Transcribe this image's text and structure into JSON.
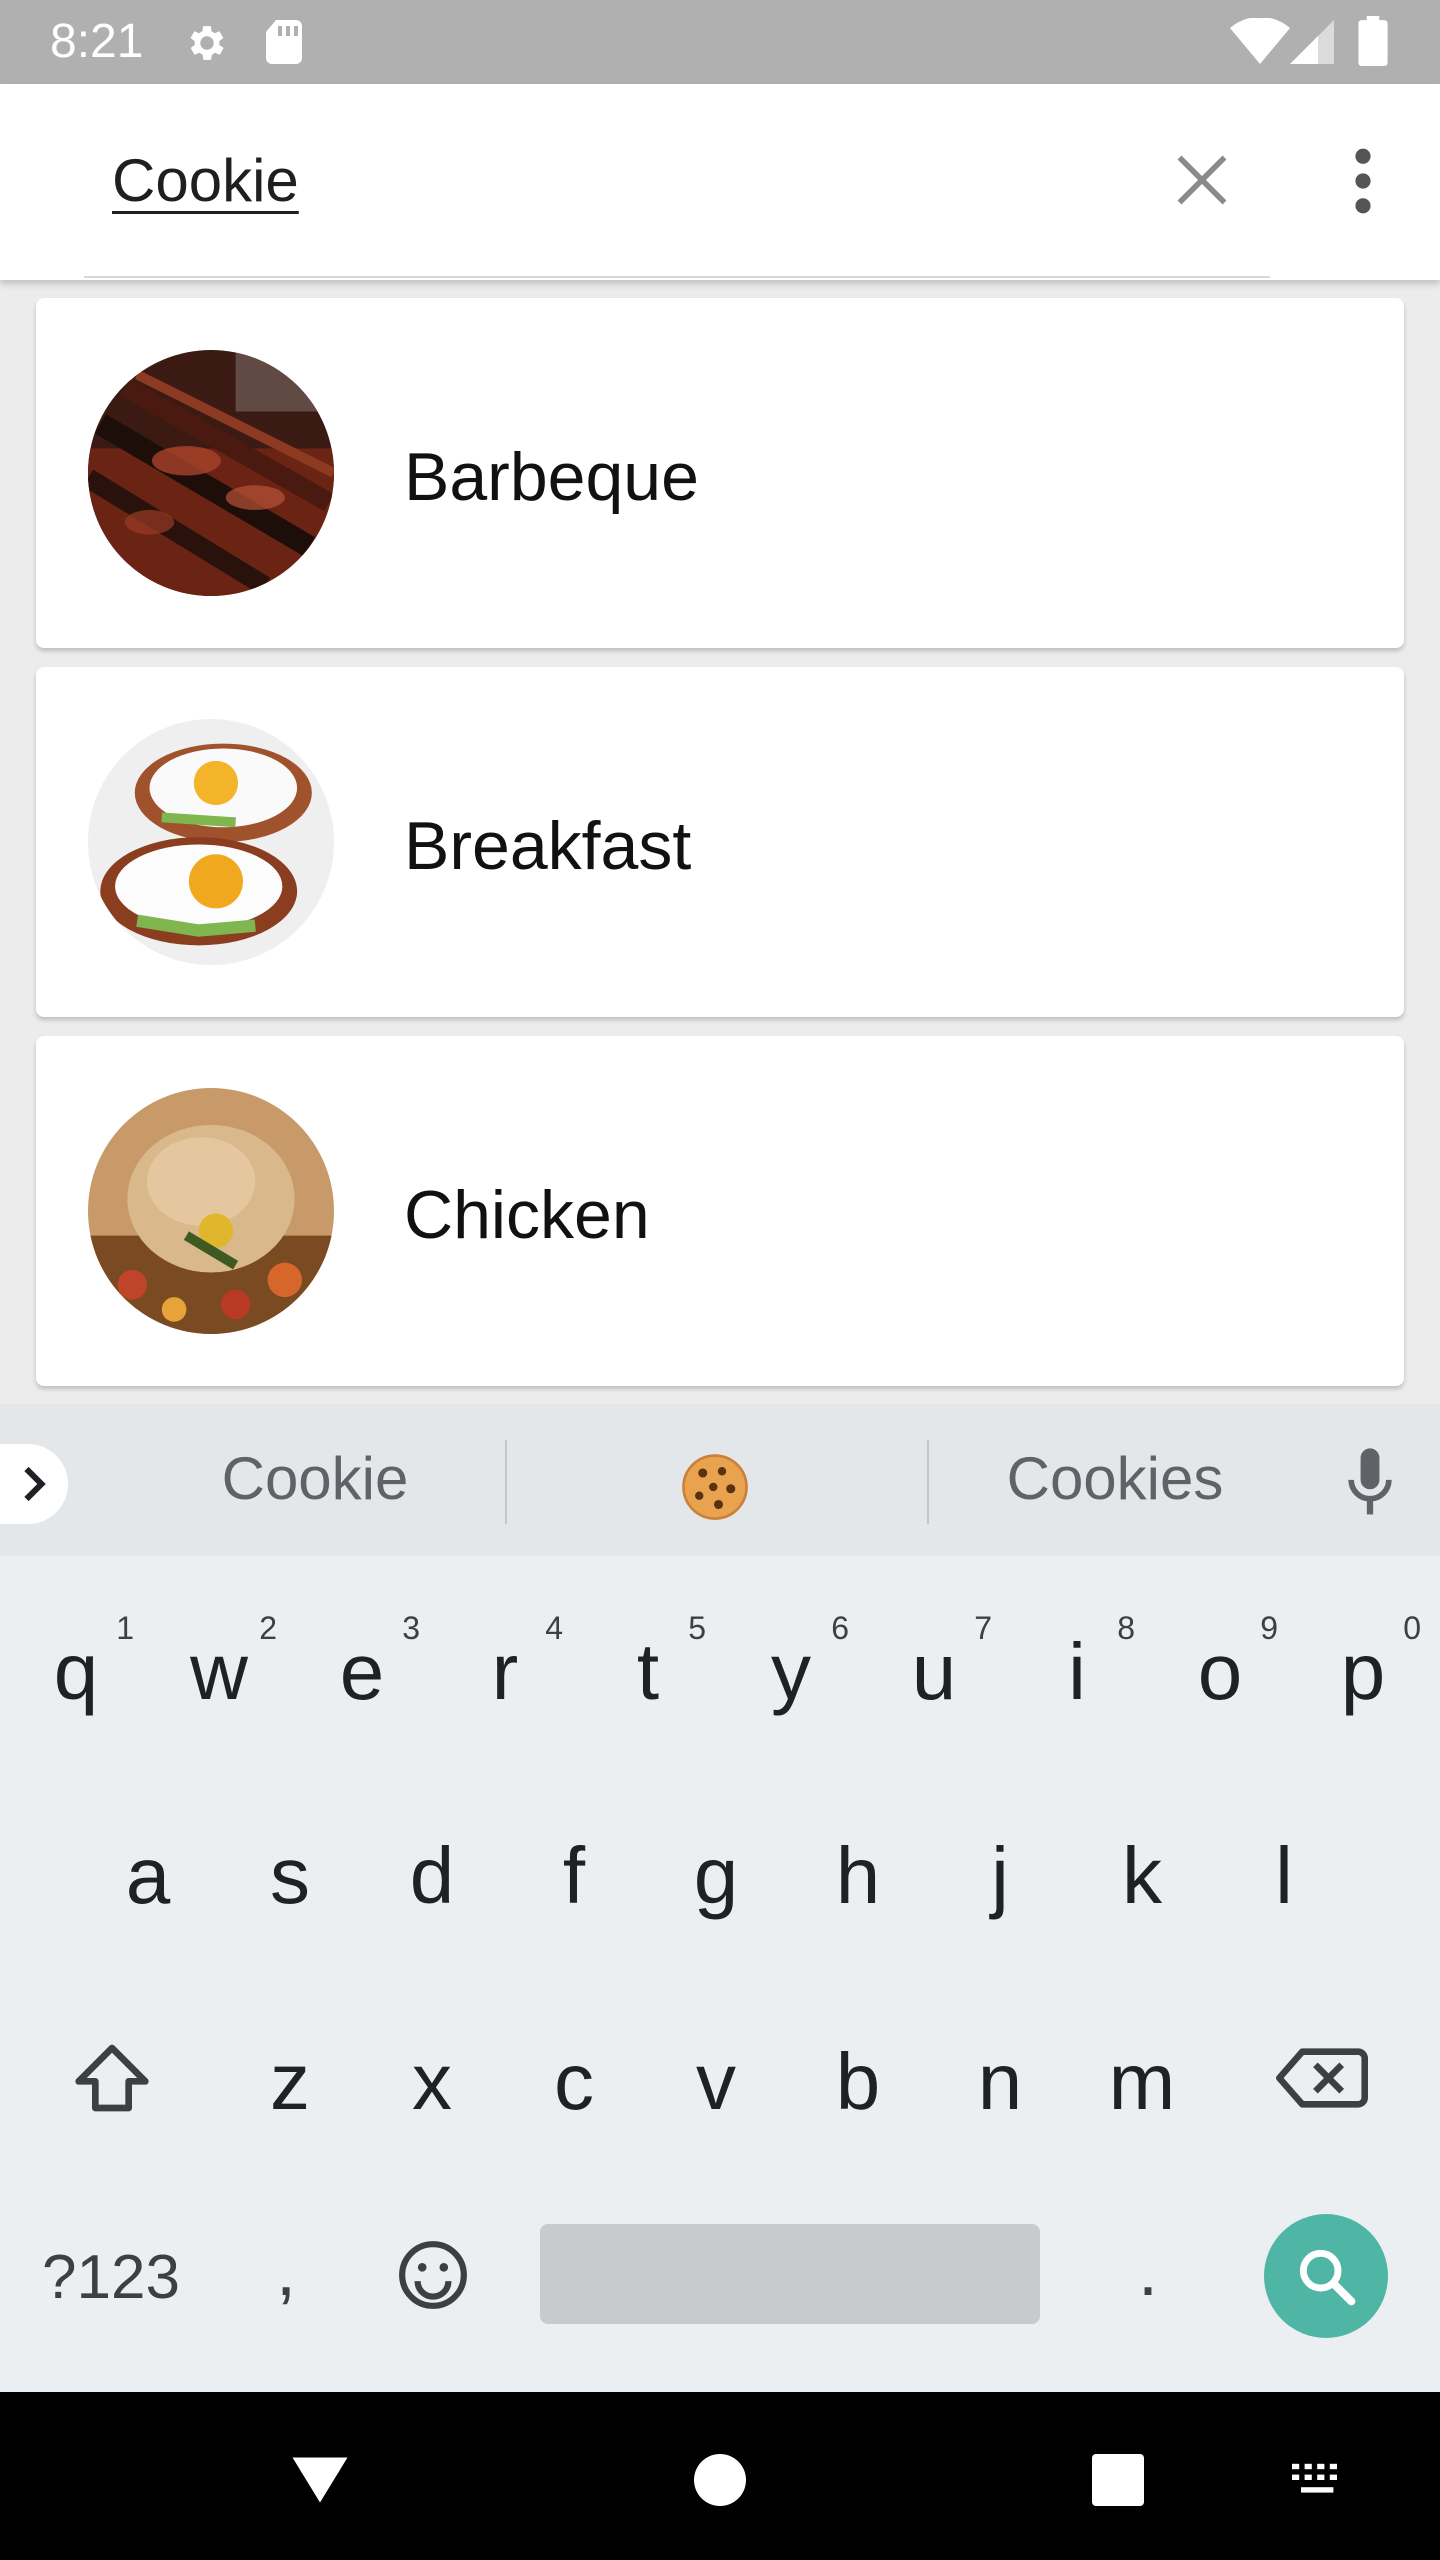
{
  "status_bar": {
    "time": "8:21",
    "icons": [
      "gear-icon",
      "sd-card-icon",
      "wifi-icon",
      "cell-signal-icon",
      "battery-icon"
    ]
  },
  "search": {
    "query": "Cookie",
    "clear_icon": "close-icon",
    "menu_icon": "more-vert-icon"
  },
  "categories": [
    {
      "label": "Barbeque",
      "image": "barbeque-ribs-photo"
    },
    {
      "label": "Breakfast",
      "image": "eggs-on-toast-photo"
    },
    {
      "label": "Chicken",
      "image": "roast-chicken-photo"
    }
  ],
  "keyboard": {
    "suggestions": [
      "Cookie",
      "Cookies"
    ],
    "emoji_suggestion": "cookie-emoji",
    "row1": [
      {
        "key": "q",
        "hint": "1"
      },
      {
        "key": "w",
        "hint": "2"
      },
      {
        "key": "e",
        "hint": "3"
      },
      {
        "key": "r",
        "hint": "4"
      },
      {
        "key": "t",
        "hint": "5"
      },
      {
        "key": "y",
        "hint": "6"
      },
      {
        "key": "u",
        "hint": "7"
      },
      {
        "key": "i",
        "hint": "8"
      },
      {
        "key": "o",
        "hint": "9"
      },
      {
        "key": "p",
        "hint": "0"
      }
    ],
    "row2": [
      "a",
      "s",
      "d",
      "f",
      "g",
      "h",
      "j",
      "k",
      "l"
    ],
    "row3": [
      "z",
      "x",
      "c",
      "v",
      "b",
      "n",
      "m"
    ],
    "symbols_label": "?123",
    "comma": ",",
    "period": ".",
    "accent_color": "#4fb6a6"
  },
  "colors": {
    "status_bar": "#b0b0b0",
    "keyboard_bg": "#eceff1",
    "list_bg": "#ececec"
  }
}
